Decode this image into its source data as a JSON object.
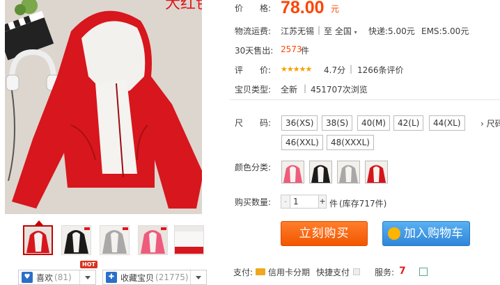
{
  "product": {
    "color_banner": "大红色",
    "thumbnails": [
      "thumb-red",
      "thumb-black",
      "thumb-grey",
      "thumb-pink",
      "thumb-white"
    ]
  },
  "actions_left": {
    "like_label": "喜欢",
    "like_count": "(81)",
    "hot_badge": "HOT",
    "fav_label": "收藏宝贝",
    "fav_count": "(21775)"
  },
  "info": {
    "price_label": "价　　格:",
    "price_value": "78.00",
    "price_unit": "元",
    "shipping_label": "物流运费:",
    "shipping_from": "江苏无锡",
    "shipping_sep": "|",
    "shipping_to": "至  全国",
    "shipping_express": "快递:5.00元",
    "shipping_ems": "EMS:5.00元",
    "sold_label": "30天售出:",
    "sold_value": "2573",
    "sold_unit": "件",
    "rating_label": "评　　价:",
    "rating_stars": "★★★★★",
    "rating_value": "4.7分",
    "rating_sep": "|",
    "rating_count": "1266条评价",
    "type_label": "宝贝类型:",
    "type_value": "全新",
    "type_sep": "|",
    "views": "451707次浏览"
  },
  "size": {
    "label": "尺　　码:",
    "options": [
      "36(XS)",
      "38(S)",
      "40(M)",
      "42(L)",
      "44(XL)",
      "46(XXL)",
      "48(XXXL)"
    ],
    "more": "› 尺码"
  },
  "color": {
    "label": "颜色分类:",
    "swatches": [
      "pink",
      "black",
      "grey",
      "red"
    ]
  },
  "quantity": {
    "label": "购买数量:",
    "minus": "-",
    "value": "1",
    "plus": "+",
    "unit": "件",
    "stock": "(库存717件)"
  },
  "buttons": {
    "buy_now": "立刻购买",
    "add_to_cart": "加入购物车"
  },
  "footer": {
    "pay_label": "支付:",
    "credit": "信用卡分期",
    "quick_pay": "快捷支付",
    "service_label": "服务:"
  },
  "colors": {
    "price": "#ff4400",
    "buy_now": "#f25600",
    "add_cart": "#2f86d8",
    "hot": "#d9331e"
  }
}
